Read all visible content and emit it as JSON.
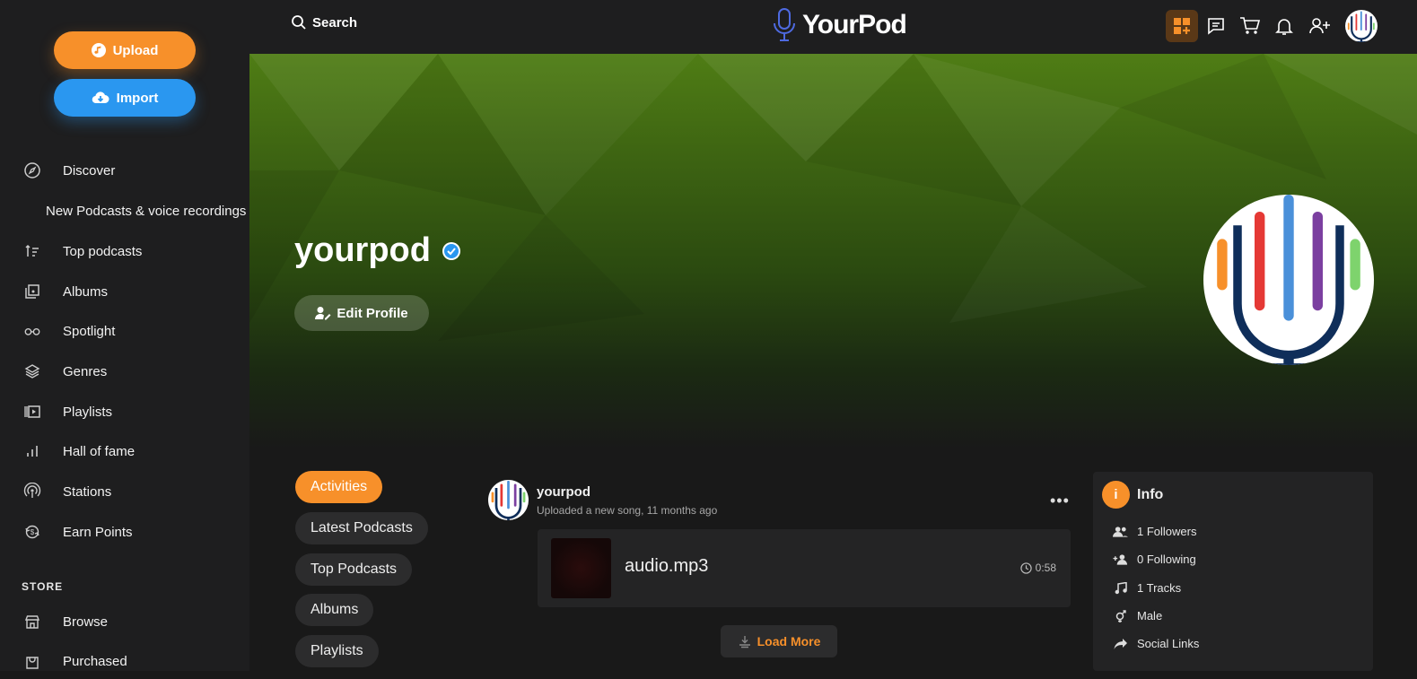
{
  "app": {
    "name": "YourPod"
  },
  "sidebar": {
    "upload_label": "Upload",
    "import_label": "Import",
    "items": [
      {
        "label": "Discover",
        "icon": "compass-icon"
      },
      {
        "label": "Top podcasts",
        "icon": "sort-icon"
      },
      {
        "label": "Albums",
        "icon": "album-icon"
      },
      {
        "label": "Spotlight",
        "icon": "glasses-icon"
      },
      {
        "label": "Genres",
        "icon": "layers-icon"
      },
      {
        "label": "Playlists",
        "icon": "playlist-icon"
      },
      {
        "label": "Hall of fame",
        "icon": "bar-chart-icon"
      },
      {
        "label": "Stations",
        "icon": "broadcast-icon"
      },
      {
        "label": "Earn Points",
        "icon": "points-icon"
      }
    ],
    "subitem": "New Podcasts & voice recordings",
    "store_heading": "STORE",
    "store_items": [
      {
        "label": "Browse",
        "icon": "store-icon"
      },
      {
        "label": "Purchased",
        "icon": "bag-icon"
      }
    ]
  },
  "header": {
    "search_label": "Search",
    "logo_text": "YourPod",
    "icons": [
      "apps-add-icon",
      "chat-icon",
      "cart-icon",
      "bell-icon",
      "add-user-icon",
      "avatar"
    ]
  },
  "profile": {
    "name": "yourpod",
    "verified": true,
    "edit_label": "Edit Profile"
  },
  "tabs": [
    "Activities",
    "Latest Podcasts",
    "Top Podcasts",
    "Albums",
    "Playlists"
  ],
  "activity": {
    "user": "yourpod",
    "meta": "Uploaded a new song, 11 months ago",
    "more": "•••",
    "track_title": "audio.mp3",
    "track_duration": "0:58",
    "load_more": "Load More"
  },
  "info": {
    "title": "Info",
    "badge": "i",
    "rows": [
      {
        "label": "1 Followers",
        "icon": "followers-icon"
      },
      {
        "label": "0 Following",
        "icon": "following-icon"
      },
      {
        "label": "1 Tracks",
        "icon": "music-note-icon"
      },
      {
        "label": "Male",
        "icon": "gender-icon"
      },
      {
        "label": "Social Links",
        "icon": "share-icon"
      }
    ]
  },
  "colors": {
    "accent": "#f7902a",
    "blue": "#2a97f0",
    "bg": "#191919",
    "panel": "#1e1e1f"
  }
}
